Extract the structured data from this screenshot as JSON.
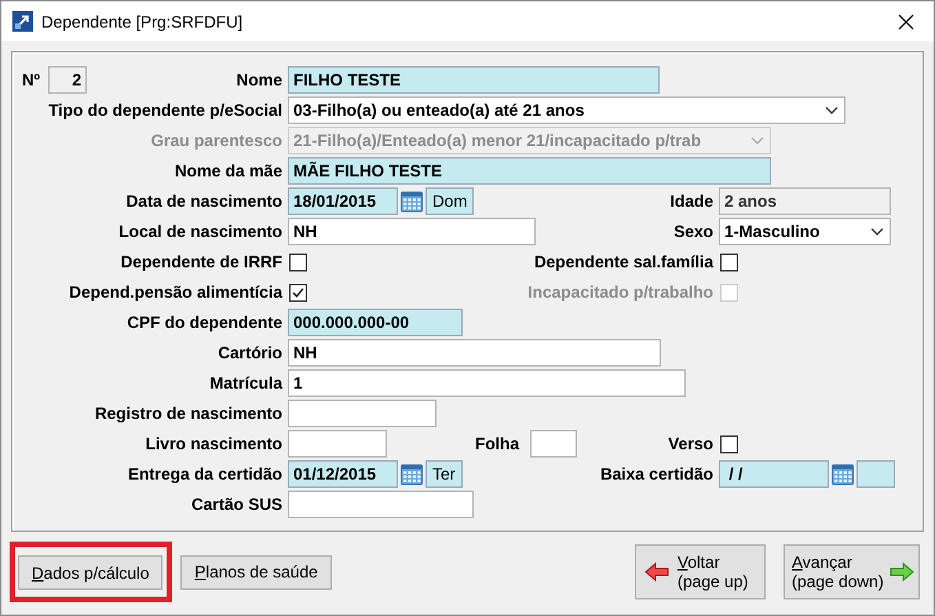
{
  "window": {
    "title": "Dependente [Prg:SRFDFU]"
  },
  "form": {
    "numero": {
      "label": "Nº",
      "value": "2",
      "highlight": false,
      "disabled": false
    },
    "nome": {
      "label": "Nome",
      "value": "FILHO TESTE",
      "highlight": true,
      "disabled": false
    },
    "tipo_dependente": {
      "label": "Tipo do dependente p/eSocial",
      "value": "03-Filho(a) ou enteado(a) até 21 anos",
      "disabled": false
    },
    "grau_parentesco": {
      "label": "Grau parentesco",
      "value": "21-Filho(a)/Enteado(a) menor 21/incapacitado p/trab",
      "disabled": true
    },
    "nome_mae": {
      "label": "Nome da mãe",
      "value": "MÃE FILHO TESTE",
      "highlight": true,
      "disabled": false
    },
    "data_nascimento": {
      "label": "Data de nascimento",
      "value": "18/01/2015",
      "weekday": "Dom",
      "highlight": true,
      "disabled": false
    },
    "idade": {
      "label": "Idade",
      "value": "2 anos",
      "highlight": false,
      "readonly": true
    },
    "local_nascimento": {
      "label": "Local de nascimento",
      "value": "NH",
      "highlight": false,
      "disabled": false
    },
    "sexo": {
      "label": "Sexo",
      "value": "1-Masculino",
      "disabled": false
    },
    "dependente_irrf": {
      "label": "Dependente de IRRF",
      "checked": false,
      "disabled": false
    },
    "dependente_sal_familia": {
      "label": "Dependente sal.família",
      "checked": false,
      "disabled": false
    },
    "pensao_alimenticia": {
      "label": "Depend.pensão alimentícia",
      "checked": true,
      "disabled": false
    },
    "incapacitado": {
      "label": "Incapacitado p/trabalho",
      "checked": false,
      "disabled": true
    },
    "cpf": {
      "label": "CPF do dependente",
      "value": "000.000.000-00",
      "highlight": true,
      "disabled": false
    },
    "cartorio": {
      "label": "Cartório",
      "value": "NH",
      "highlight": false,
      "disabled": false
    },
    "matricula": {
      "label": "Matrícula",
      "value": "1",
      "highlight": false,
      "disabled": false
    },
    "registro_nascimento": {
      "label": "Registro de nascimento",
      "highlight": false,
      "disabled": false
    },
    "livro_nascimento": {
      "label": "Livro nascimento",
      "highlight": false,
      "disabled": false
    },
    "folha": {
      "label": "Folha",
      "highlight": false,
      "disabled": false
    },
    "verso": {
      "label": "Verso",
      "checked": false,
      "disabled": false
    },
    "entrega_certidao": {
      "label": "Entrega da certidão",
      "value": "01/12/2015",
      "weekday": "Ter",
      "highlight": true,
      "disabled": false
    },
    "baixa_certidao": {
      "label": "Baixa certidão",
      "value": " / /",
      "highlight": true,
      "disabled": false
    },
    "cartao_sus": {
      "label": "Cartão SUS",
      "highlight": false,
      "disabled": false
    }
  },
  "buttons": [
    {
      "label": "Dados p/cálculo",
      "highlighted": true
    },
    {
      "label": "Planos de saúde",
      "highlighted": false
    }
  ],
  "nav_buttons": [
    {
      "kind": "back",
      "label": "Voltar",
      "hint": "(page up)"
    },
    {
      "kind": "forward",
      "label": "Avançar",
      "hint": "(page down)"
    }
  ]
}
